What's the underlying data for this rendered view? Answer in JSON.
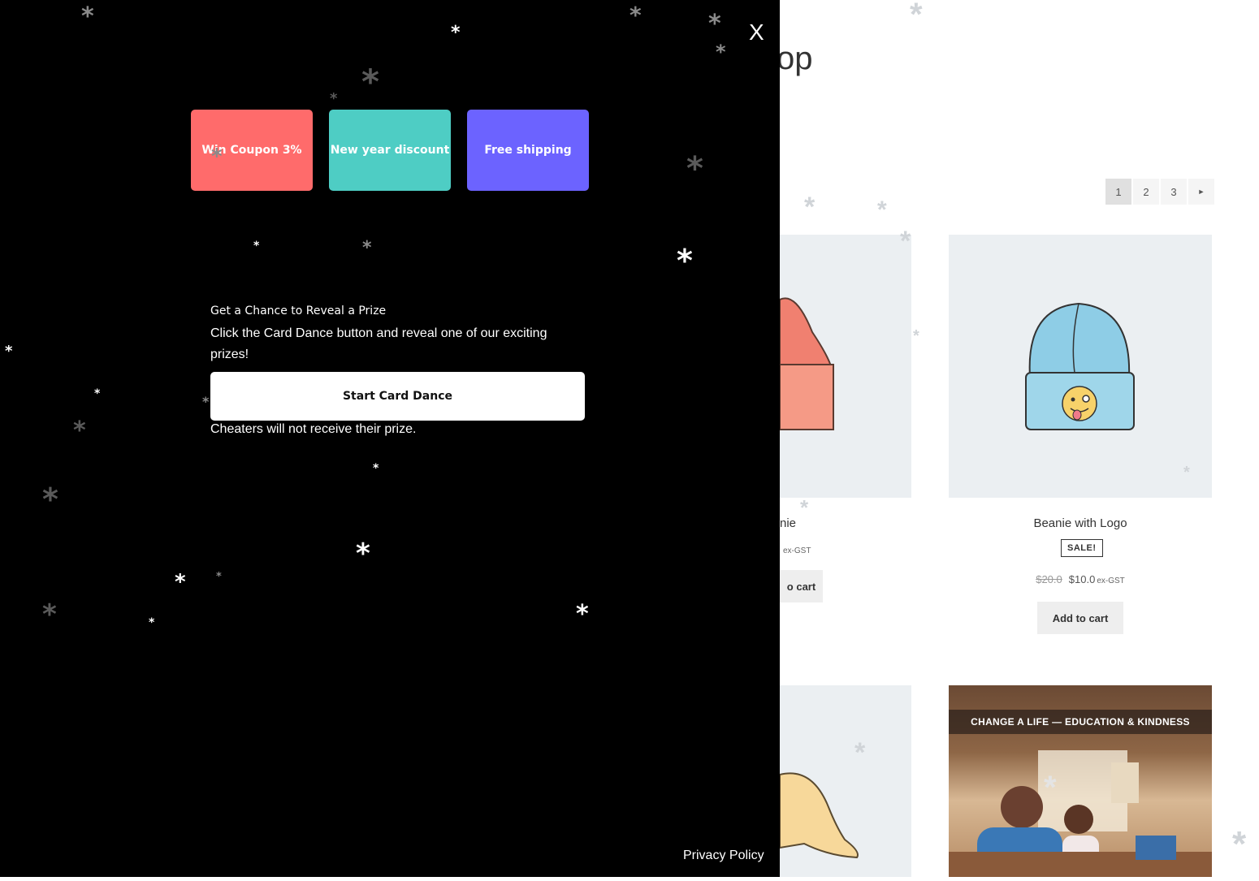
{
  "shop": {
    "title_fragment": "op",
    "pagination": [
      "1",
      "2",
      "3"
    ],
    "pagination_next": "►",
    "products": [
      {
        "name": "nie",
        "price_gst": "ex-GST",
        "cart_label": "o cart"
      },
      {
        "name": "Beanie with Logo",
        "badge": "SALE!",
        "old_price": "$20.0",
        "price": "$10.0",
        "price_gst": "ex-GST",
        "cart_label": "Add to cart"
      }
    ],
    "promo_banner": "CHANGE A LIFE — EDUCATION & KINDNESS"
  },
  "overlay": {
    "close_label": "X",
    "prizes": [
      {
        "label": "Win Coupon 3%",
        "color": "#ff6b6b"
      },
      {
        "label": "New year discount",
        "color": "#4ecdc4"
      },
      {
        "label": "Free shipping",
        "color": "#6c63ff"
      }
    ],
    "heading": "Get a Chance to Reveal a Prize",
    "description": "Click the Card Dance button and reveal one of our exciting prizes!",
    "button_label": "Start Card Dance",
    "warning": "Cheaters will not receive their prize.",
    "privacy_link": "Privacy Policy"
  }
}
